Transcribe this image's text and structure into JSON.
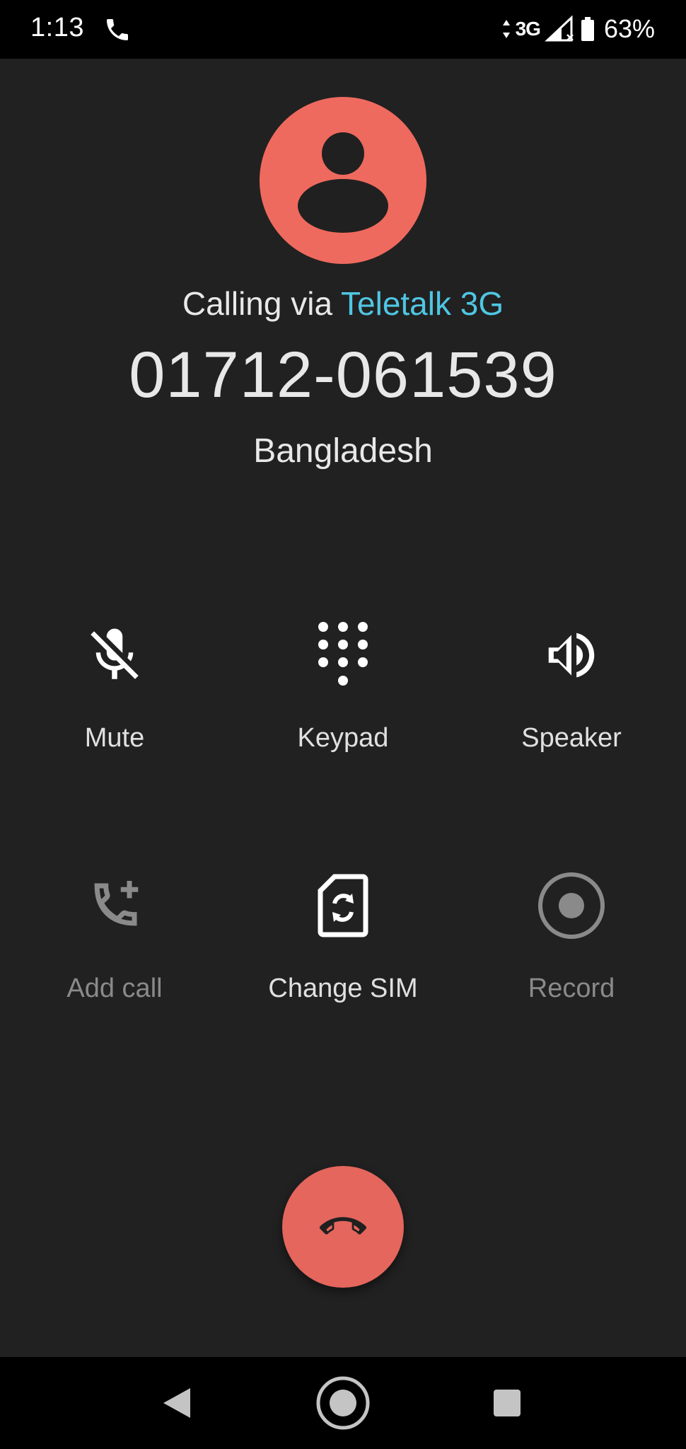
{
  "status_bar": {
    "time": "1:13",
    "network": "3G",
    "battery": "63%"
  },
  "call": {
    "calling_via_prefix": "Calling via",
    "carrier": "Teletalk 3G",
    "number": "01712-061539",
    "location": "Bangladesh"
  },
  "actions": {
    "mute": "Mute",
    "keypad": "Keypad",
    "speaker": "Speaker",
    "add_call": "Add call",
    "change_sim": "Change SIM",
    "record": "Record"
  },
  "colors": {
    "background": "#212121",
    "avatar": "#ef6a5e",
    "carrier_accent": "#4fc6e3",
    "end_call": "#e4665d"
  },
  "icons": {
    "mute": "mic-off-icon",
    "keypad": "dialpad-icon",
    "speaker": "volume-up-icon",
    "add_call": "add-call-icon",
    "change_sim": "sim-swap-icon",
    "record": "record-icon",
    "end_call": "call-end-icon"
  }
}
